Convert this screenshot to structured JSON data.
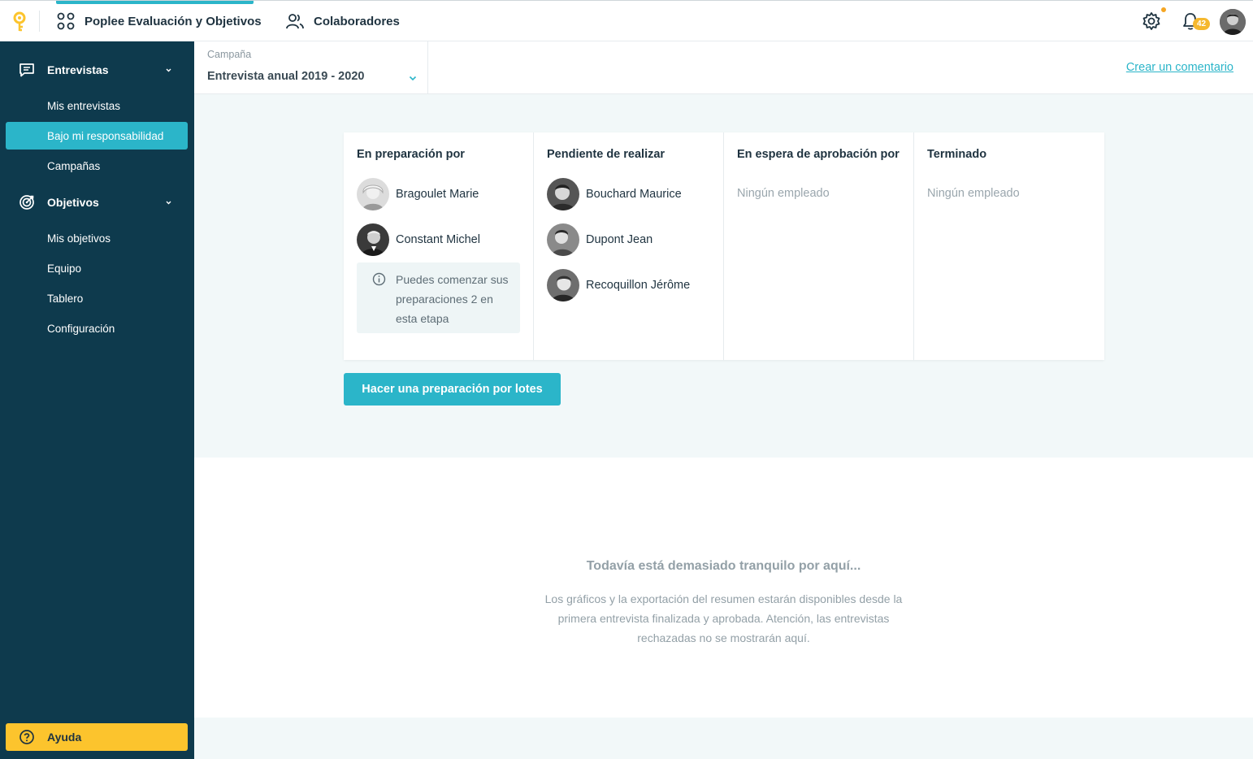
{
  "topbar": {
    "app_name": "Poplee Evaluación y Objetivos",
    "collaborators_label": "Colaboradores",
    "notifications_count": "42"
  },
  "sidebar": {
    "sections": [
      {
        "label": "Entrevistas",
        "items": [
          {
            "label": "Mis entrevistas"
          },
          {
            "label": "Bajo mi responsabilidad"
          },
          {
            "label": "Campañas"
          }
        ]
      },
      {
        "label": "Objetivos",
        "items": [
          {
            "label": "Mis objetivos"
          },
          {
            "label": "Equipo"
          },
          {
            "label": "Tablero"
          },
          {
            "label": "Configuración"
          }
        ]
      }
    ],
    "help_label": "Ayuda"
  },
  "filter": {
    "campaign_label": "Campaña",
    "campaign_value": "Entrevista anual 2019 - 2020",
    "create_comment": "Crear un comentario"
  },
  "board": {
    "columns": [
      {
        "title": "En preparación por",
        "people": [
          "Bragoulet Marie",
          "Constant Michel"
        ],
        "info": "Puedes comenzar sus preparaciones 2 en esta etapa"
      },
      {
        "title": "Pendiente de realizar",
        "people": [
          "Bouchard Maurice",
          "Dupont Jean",
          "Recoquillon Jérôme"
        ]
      },
      {
        "title": "En espera de aprobación por",
        "empty": "Ningún empleado"
      },
      {
        "title": "Terminado",
        "empty": "Ningún empleado"
      }
    ],
    "batch_button": "Hacer una preparación por lotes"
  },
  "empty_state": {
    "title": "Todavía está demasiado tranquilo por aquí...",
    "description": "Los gráficos y la exportación del resumen estarán disponibles desde la primera entrevista finalizada y aprobada. Atención, las entrevistas rechazadas no se mostrarán aquí."
  },
  "colors": {
    "sidebar_bg": "#0e3a4d",
    "accent": "#2bb5c9",
    "help_yellow": "#fcc42d"
  }
}
